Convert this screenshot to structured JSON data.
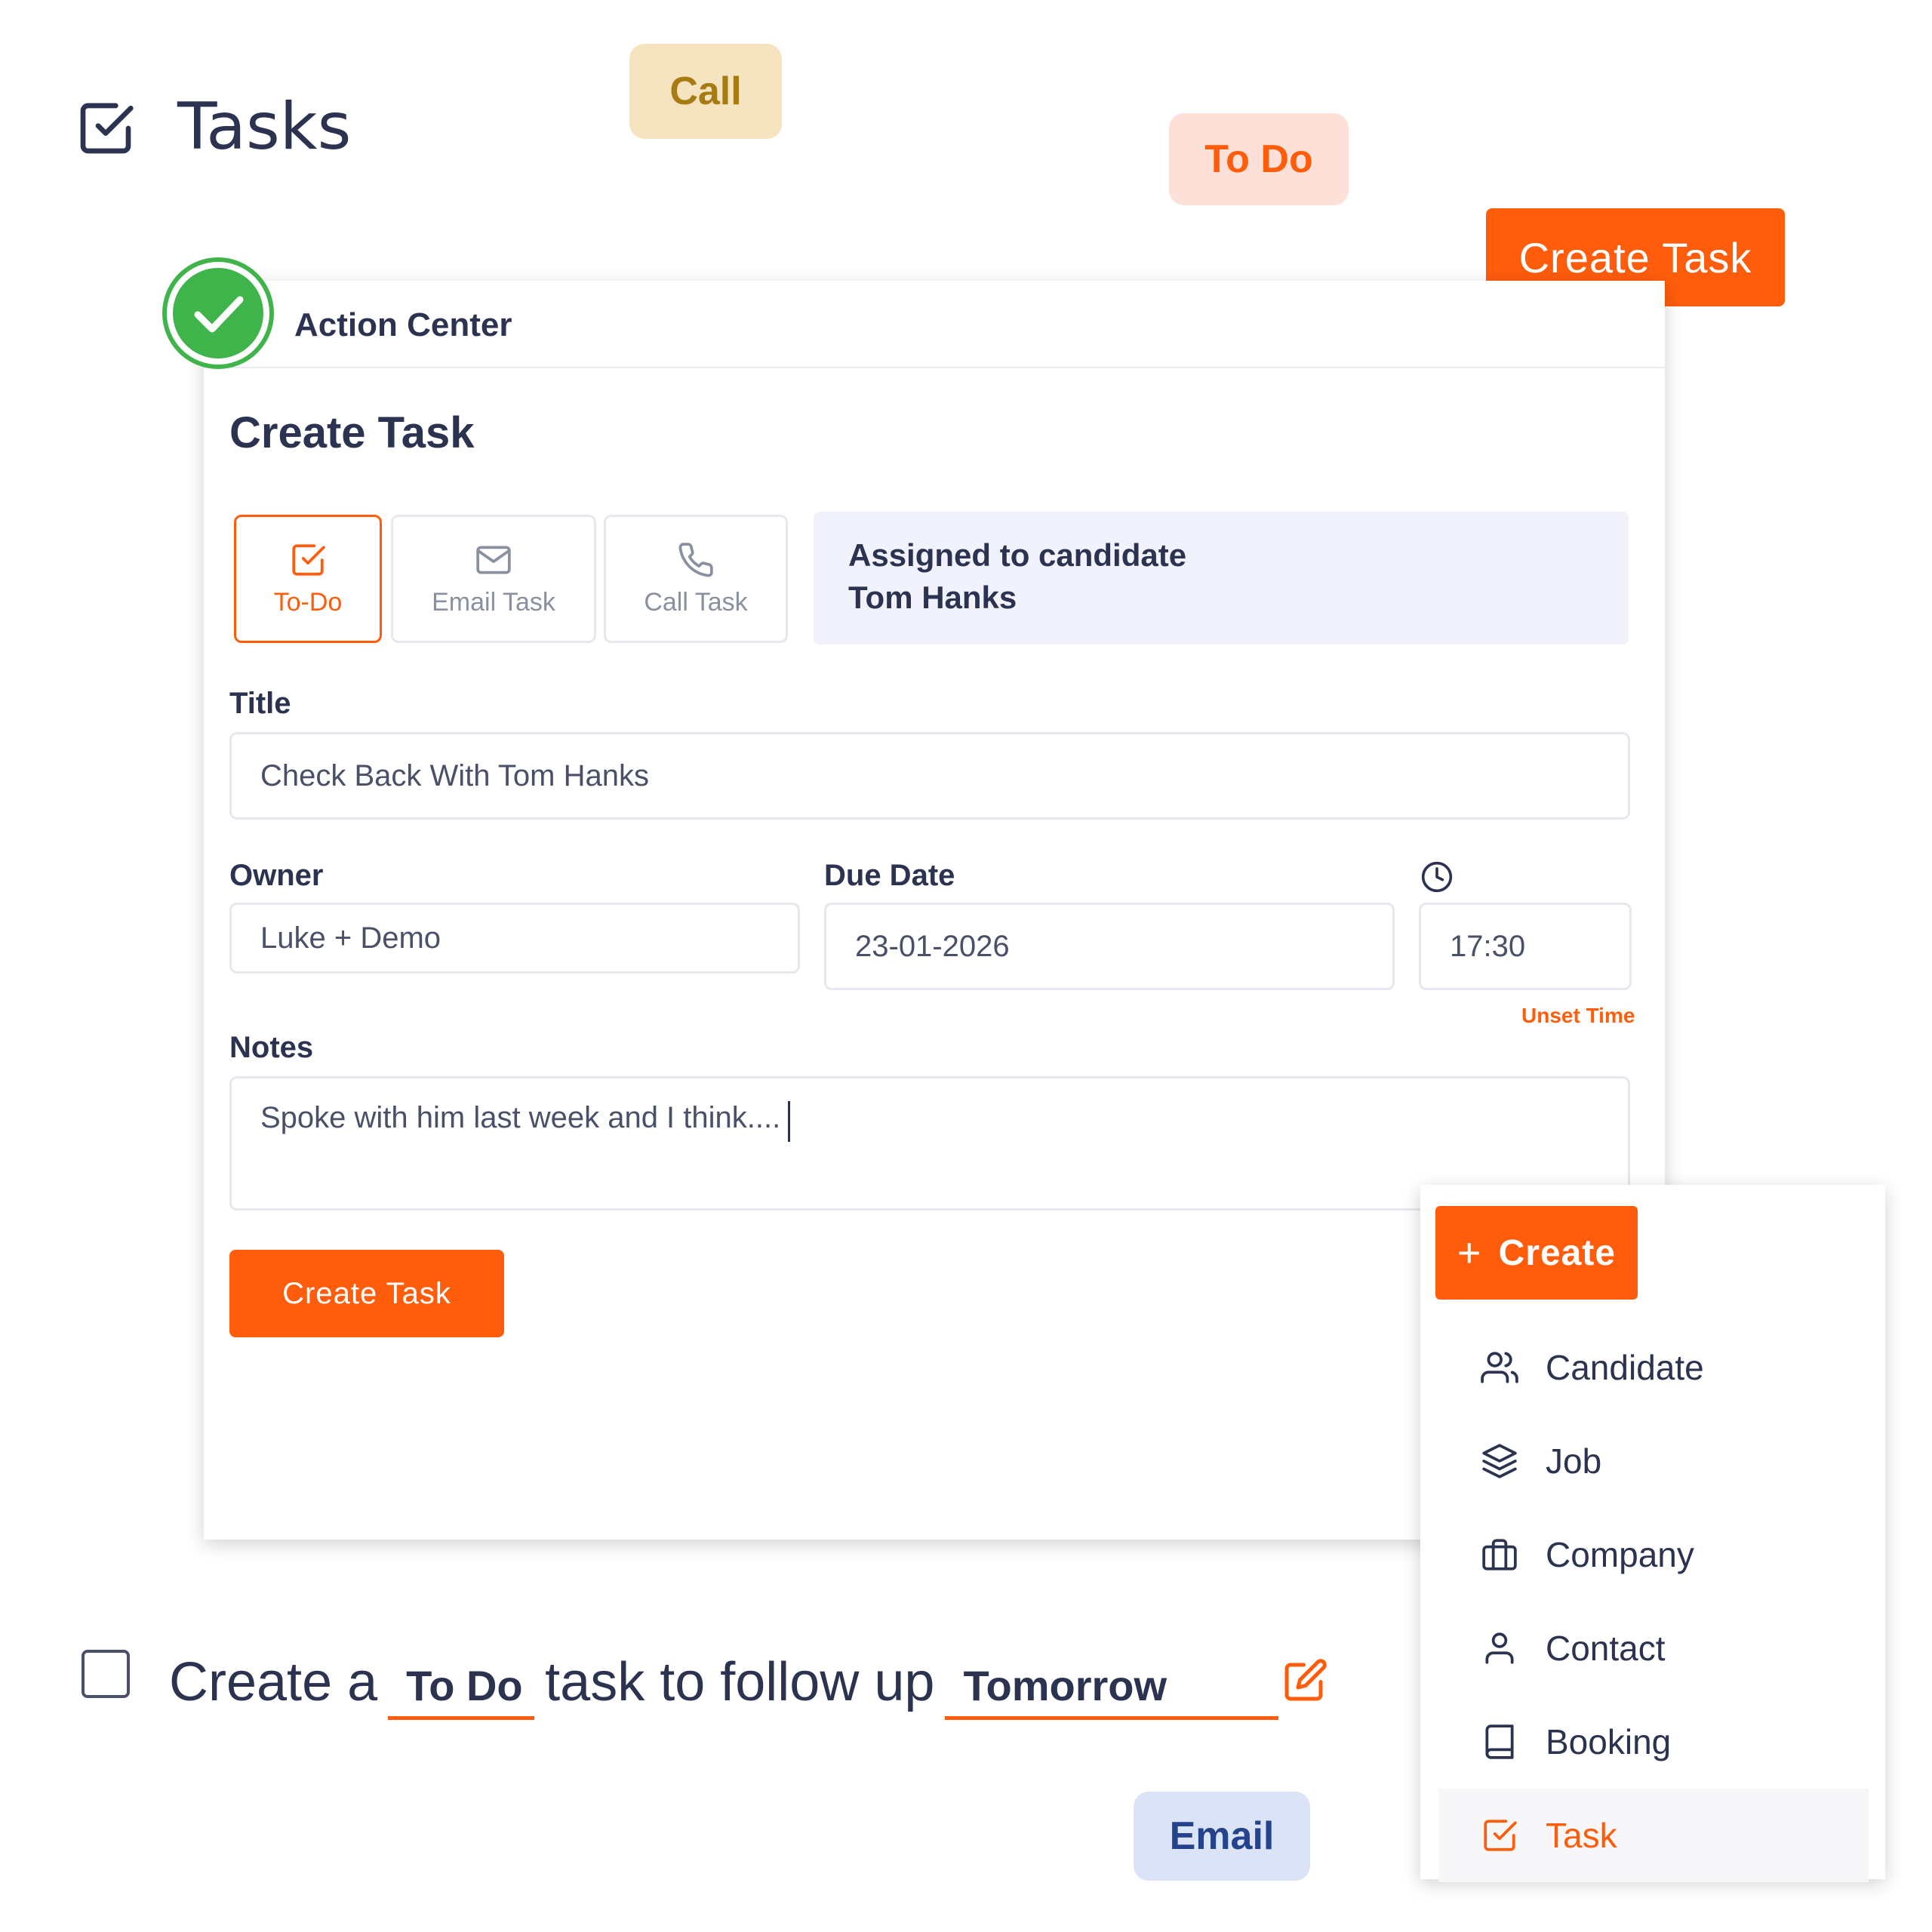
{
  "header": {
    "title": "Tasks",
    "icon": "checkbox-icon"
  },
  "pills": {
    "call": "Call",
    "todo": "To Do",
    "email": "Email"
  },
  "top_create_button": "Create Task",
  "card": {
    "header_title": "Action Center",
    "form_title": "Create Task",
    "task_types": [
      {
        "label": "To-Do",
        "icon": "checkbox-icon",
        "active": true
      },
      {
        "label": "Email Task",
        "icon": "mail-icon",
        "active": false
      },
      {
        "label": "Call Task",
        "icon": "phone-icon",
        "active": false
      }
    ],
    "assigned": {
      "line1": "Assigned to candidate",
      "line2": "Tom Hanks"
    },
    "fields": {
      "title_label": "Title",
      "title_value": "Check Back With Tom Hanks",
      "owner_label": "Owner",
      "owner_value": "Luke + Demo",
      "due_label": "Due Date",
      "due_value": "23-01-2026",
      "time_value": "17:30",
      "unset_time": "Unset Time",
      "notes_label": "Notes",
      "notes_value": "Spoke with him last week and I think...."
    },
    "submit_label": "Create Task"
  },
  "menu": {
    "create_label": "Create",
    "items": [
      {
        "label": "Candidate",
        "icon": "users-icon"
      },
      {
        "label": "Job",
        "icon": "layers-icon"
      },
      {
        "label": "Company",
        "icon": "briefcase-icon"
      },
      {
        "label": "Contact",
        "icon": "user-icon"
      },
      {
        "label": "Booking",
        "icon": "book-icon"
      },
      {
        "label": "Task",
        "icon": "checkbox-icon",
        "active": true
      }
    ]
  },
  "sentence": {
    "part1": "Create a",
    "blank1": "To Do",
    "part2": "task to follow up",
    "blank2": "Tomorrow"
  },
  "colors": {
    "accent": "#ff5d0b",
    "text": "#2b3350",
    "success": "#3fb44a"
  }
}
